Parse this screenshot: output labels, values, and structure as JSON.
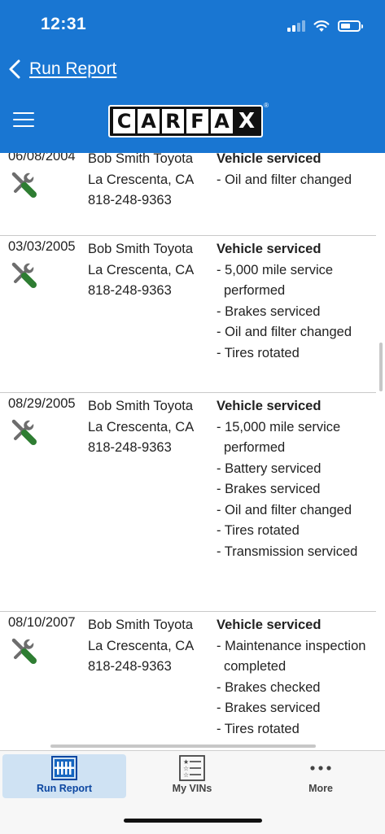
{
  "status_bar": {
    "time": "12:31",
    "icons": [
      "cellular-signal-icon",
      "wifi-icon",
      "battery-icon"
    ]
  },
  "nav": {
    "back_label": "Run Report"
  },
  "brand": {
    "logo_letters": [
      "C",
      "A",
      "R",
      "F",
      "A",
      "X"
    ],
    "logo_mark": "®",
    "logo_alt": "CARFAX",
    "menu_icon": "hamburger-menu-icon"
  },
  "colors": {
    "header_blue": "#1976d2",
    "wrench_green": "#2e7d32",
    "active_tab_bg": "#cfe2f3"
  },
  "records": [
    {
      "date": "06/08/2004",
      "source": [
        "Bob Smith Toyota",
        "La Crescenta, CA",
        "818-248-9363"
      ],
      "type": "Vehicle serviced",
      "items": [
        "- Oil and filter changed"
      ]
    },
    {
      "date": "03/03/2005",
      "source": [
        "Bob Smith Toyota",
        "La Crescenta, CA",
        "818-248-9363"
      ],
      "type": "Vehicle serviced",
      "items": [
        "- 5,000 mile service performed",
        "- Brakes serviced",
        "- Oil and filter changed",
        "- Tires rotated"
      ]
    },
    {
      "date": "08/29/2005",
      "source": [
        "Bob Smith Toyota",
        "La Crescenta, CA",
        "818-248-9363"
      ],
      "type": "Vehicle serviced",
      "items": [
        "- 15,000 mile service performed",
        "- Battery serviced",
        "- Brakes serviced",
        "- Oil and filter changed",
        "- Tires rotated",
        "- Transmission serviced"
      ]
    },
    {
      "date": "08/10/2007",
      "source": [
        "Bob Smith Toyota",
        "La Crescenta, CA",
        "818-248-9363"
      ],
      "type": "Vehicle serviced",
      "items": [
        "- Maintenance inspection completed",
        "- Brakes checked",
        "- Brakes serviced",
        "- Tires rotated"
      ]
    }
  ],
  "tabs": [
    {
      "label": "Run Report",
      "icon": "run-report-icon",
      "active": true
    },
    {
      "label": "My VINs",
      "icon": "my-vins-icon",
      "active": false
    },
    {
      "label": "More",
      "icon": "more-dots-icon",
      "active": false
    }
  ]
}
